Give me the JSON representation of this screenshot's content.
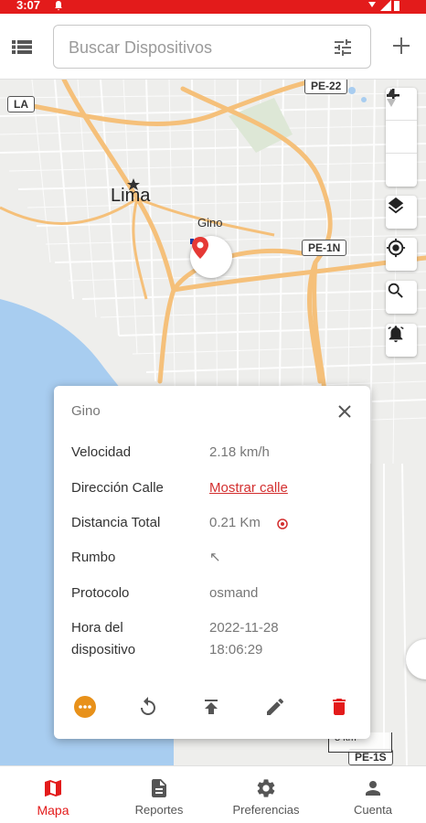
{
  "status": {
    "time": "3:07"
  },
  "search": {
    "placeholder": "Buscar Dispositivos"
  },
  "map": {
    "city": "Lima",
    "device_label": "Gino",
    "roads": {
      "la": "LA",
      "pe22": "PE-22",
      "pe1n": "PE-1N",
      "pe1s": "PE-1S"
    },
    "scale": "3 km"
  },
  "card": {
    "title": "Gino",
    "rows": [
      {
        "label": "Velocidad",
        "value": "2.18 km/h"
      },
      {
        "label": "Dirección Calle",
        "value": "Mostrar calle"
      },
      {
        "label": "Distancia Total",
        "value": "0.21 Km"
      },
      {
        "label": "Rumbo",
        "value": "↖"
      },
      {
        "label": "Protocolo",
        "value": "osmand"
      },
      {
        "label": "Hora del dispositivo",
        "value": "2022-11-28 18:06:29"
      }
    ]
  },
  "nav": {
    "items": [
      {
        "label": "Mapa",
        "icon": "map-icon"
      },
      {
        "label": "Reportes",
        "icon": "document-icon"
      },
      {
        "label": "Preferencias",
        "icon": "gear-icon"
      },
      {
        "label": "Cuenta",
        "icon": "person-icon"
      }
    ]
  },
  "colors": {
    "accent": "#e31b1b",
    "more": "#e8911a",
    "delete": "#e31b1b"
  }
}
